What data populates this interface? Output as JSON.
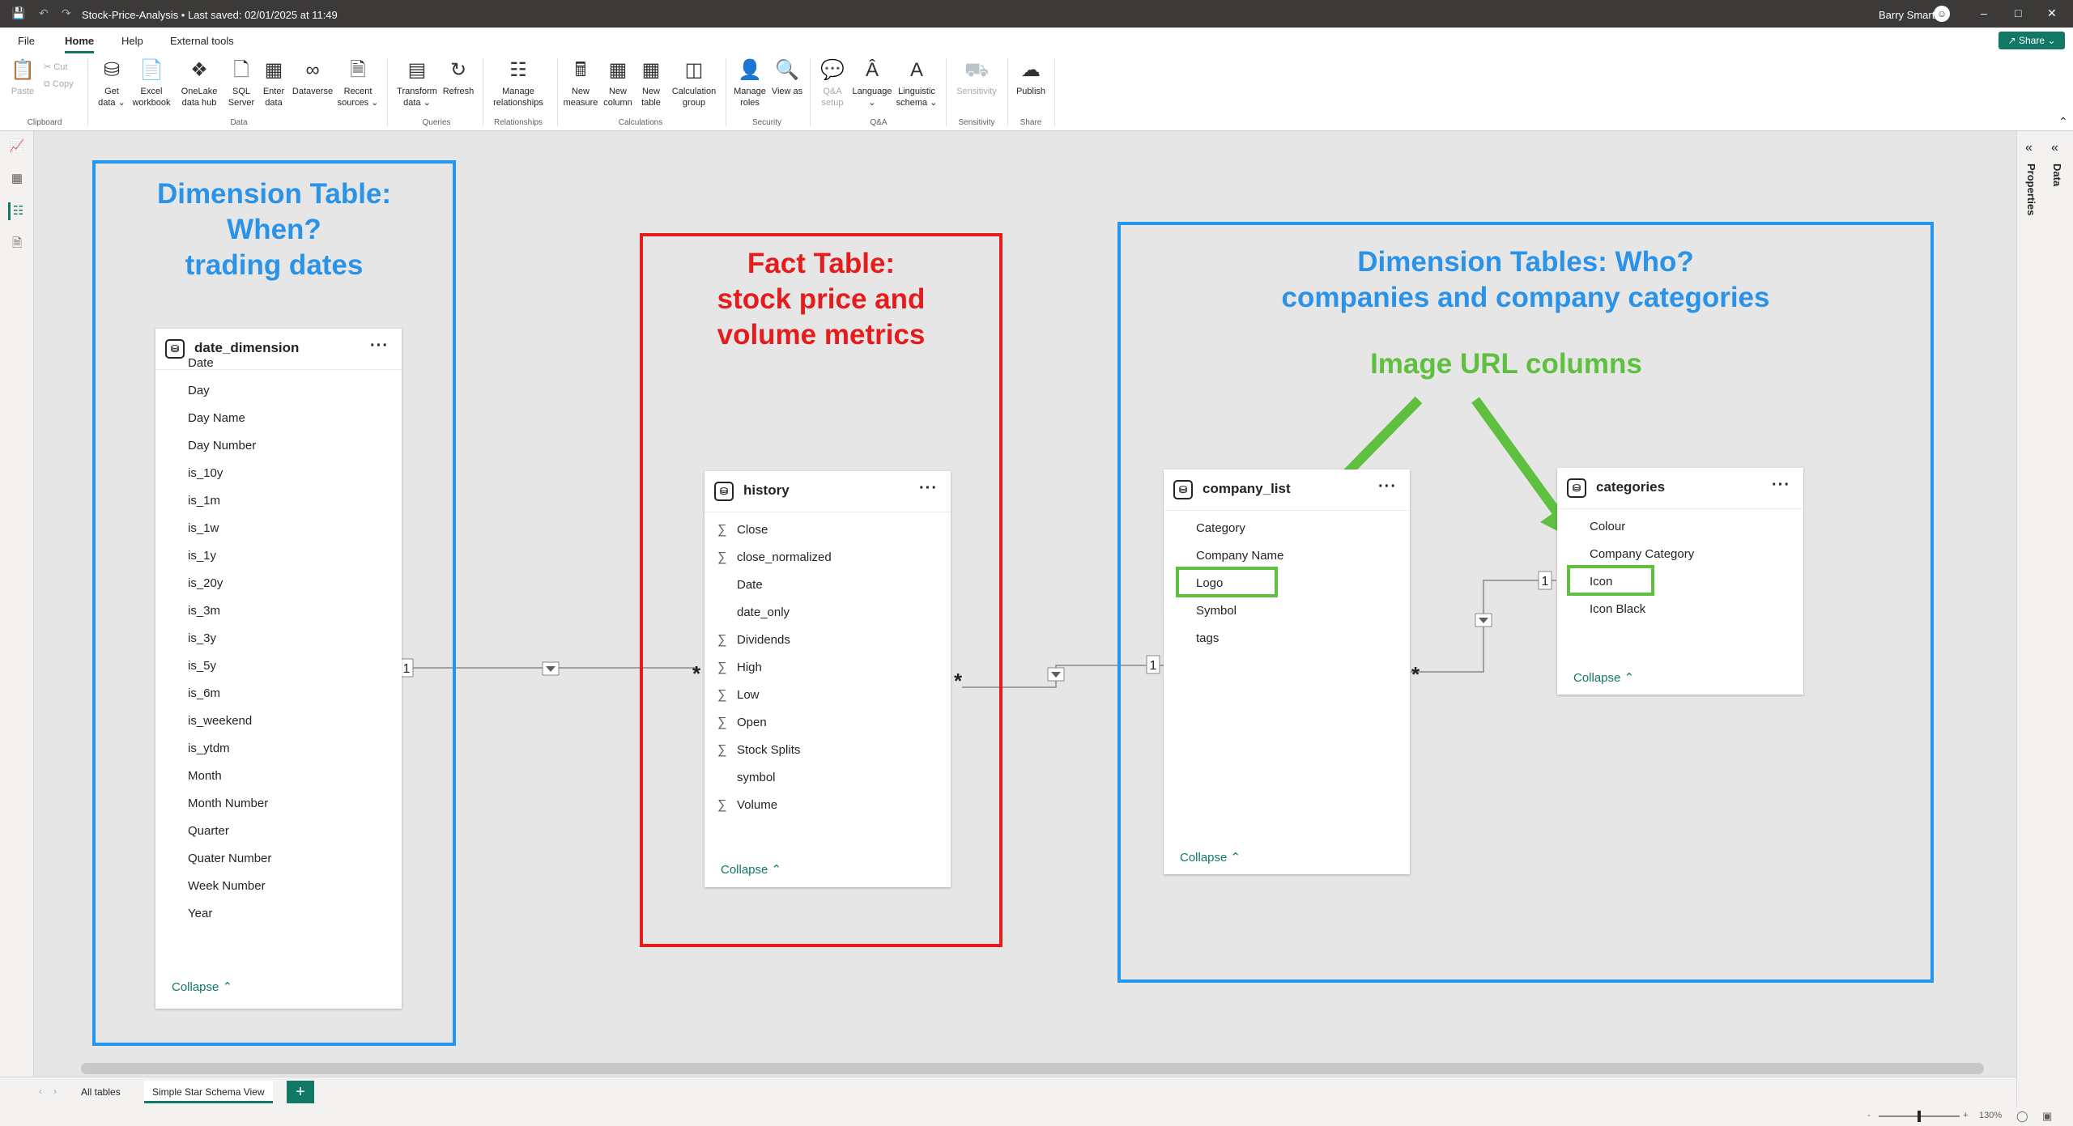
{
  "titlebar": {
    "document_title": "Stock-Price-Analysis • Last saved: 02/01/2025 at 11:49",
    "user_name": "Barry Smart",
    "icons": [
      "save-icon",
      "undo-icon",
      "redo-icon",
      "minimize-icon",
      "maximize-icon",
      "close-icon"
    ]
  },
  "menu": {
    "tabs": [
      "File",
      "Home",
      "Help",
      "External tools"
    ],
    "active_tab": "Home",
    "share_label": "Share"
  },
  "ribbon": {
    "clipboard": {
      "paste": "Paste",
      "cut": "Cut",
      "copy": "Copy",
      "group": "Clipboard"
    },
    "data": {
      "group": "Data",
      "get_data": "Get data",
      "excel_workbook": "Excel workbook",
      "onelake_data_hub": "OneLake data hub",
      "sql_server": "SQL Server",
      "enter_data": "Enter data",
      "dataverse": "Dataverse",
      "recent_sources": "Recent sources"
    },
    "queries": {
      "group": "Queries",
      "transform_data": "Transform data",
      "refresh": "Refresh"
    },
    "relationships": {
      "group": "Relationships",
      "manage_relationships": "Manage relationships"
    },
    "calculations": {
      "group": "Calculations",
      "new_measure": "New measure",
      "new_column": "New column",
      "new_table": "New table",
      "calculation_group": "Calculation group"
    },
    "security": {
      "group": "Security",
      "manage_roles": "Manage roles",
      "view_as": "View as"
    },
    "qa": {
      "group": "Q&A",
      "qa_setup": "Q&A setup",
      "language": "Language",
      "linguistic_schema": "Linguistic schema"
    },
    "sensitivity": {
      "group": "Sensitivity",
      "sensitivity": "Sensitivity"
    },
    "share": {
      "group": "Share",
      "publish": "Publish"
    }
  },
  "right_panes": {
    "properties": "Properties",
    "data": "Data"
  },
  "annotations": {
    "when": [
      "Dimension Table:",
      "When?",
      "trading dates"
    ],
    "fact": [
      "Fact Table:",
      "stock price and",
      "volume metrics"
    ],
    "who": [
      "Dimension Tables: Who?",
      "companies and company categories"
    ],
    "image_url": "Image URL columns"
  },
  "tables": {
    "date_dimension": {
      "name": "date_dimension",
      "columns": [
        "Date",
        "Day",
        "Day Name",
        "Day Number",
        "is_10y",
        "is_1m",
        "is_1w",
        "is_1y",
        "is_20y",
        "is_3m",
        "is_3y",
        "is_5y",
        "is_6m",
        "is_weekend",
        "is_ytdm",
        "Month",
        "Month Number",
        "Quarter",
        "Quater Number",
        "Week Number",
        "Year"
      ],
      "collapse": "Collapse"
    },
    "history": {
      "name": "history",
      "columns": [
        {
          "label": "Close",
          "sum": true
        },
        {
          "label": "close_normalized",
          "sum": true
        },
        {
          "label": "Date",
          "sum": false
        },
        {
          "label": "date_only",
          "sum": false
        },
        {
          "label": "Dividends",
          "sum": true
        },
        {
          "label": "High",
          "sum": true
        },
        {
          "label": "Low",
          "sum": true
        },
        {
          "label": "Open",
          "sum": true
        },
        {
          "label": "Stock Splits",
          "sum": true
        },
        {
          "label": "symbol",
          "sum": false
        },
        {
          "label": "Volume",
          "sum": true
        }
      ],
      "collapse": "Collapse"
    },
    "company_list": {
      "name": "company_list",
      "columns": [
        "Category",
        "Company Name",
        "Logo",
        "Symbol",
        "tags"
      ],
      "collapse": "Collapse"
    },
    "categories": {
      "name": "categories",
      "columns": [
        "Colour",
        "Company Category",
        "Icon",
        "Icon Black"
      ],
      "collapse": "Collapse"
    }
  },
  "relationships": [
    {
      "from": "date_dimension",
      "to": "history",
      "one_marker": "1",
      "many_marker": "*"
    },
    {
      "from": "history",
      "to": "company_list",
      "one_marker": "1",
      "many_marker": "*"
    },
    {
      "from": "company_list",
      "to": "categories",
      "one_marker": "1",
      "many_marker": "*"
    }
  ],
  "sheet_tabs": [
    "All tables",
    "Simple Star Schema View"
  ],
  "active_sheet": "Simple Star Schema View",
  "add_tab_label": "+",
  "status": {
    "zoom": "130%"
  },
  "colors": {
    "accent": "#117865",
    "blue_region": "#2196f3",
    "red_region": "#e41c1c",
    "green_highlight": "#5fbf3f"
  }
}
